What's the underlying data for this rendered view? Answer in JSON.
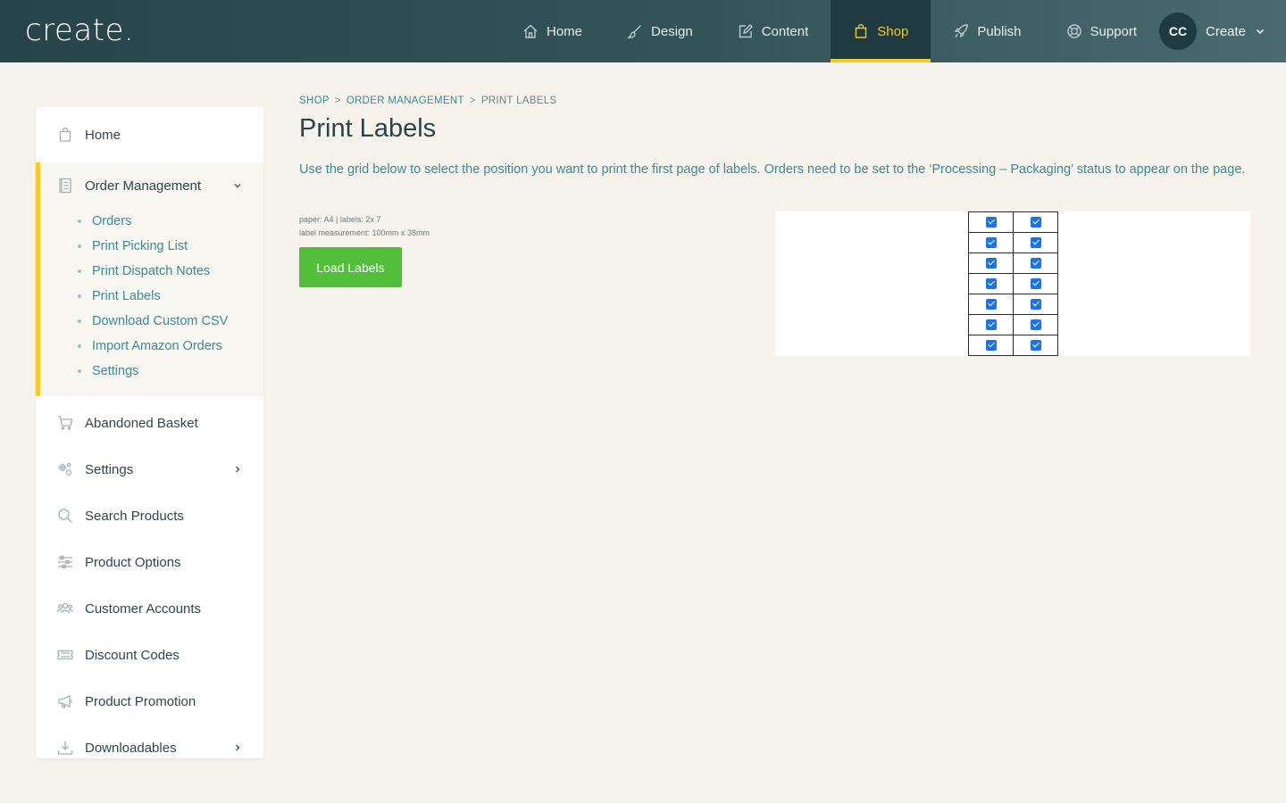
{
  "brand": {
    "logo_text": "create."
  },
  "nav": [
    {
      "label": "Home",
      "icon": "home-icon",
      "active": false
    },
    {
      "label": "Design",
      "icon": "brush-icon",
      "active": false
    },
    {
      "label": "Content",
      "icon": "edit-icon",
      "active": false
    },
    {
      "label": "Shop",
      "icon": "bag-icon",
      "active": true
    },
    {
      "label": "Publish",
      "icon": "rocket-icon",
      "active": false
    },
    {
      "label": "Support",
      "icon": "lifebuoy-icon",
      "active": false
    }
  ],
  "user": {
    "initials": "CC",
    "name": "Create"
  },
  "sidebar": {
    "home": "Home",
    "order_management": {
      "label": "Order Management",
      "items": [
        "Orders",
        "Print Picking List",
        "Print Dispatch Notes",
        "Print Labels",
        "Download Custom CSV",
        "Import Amazon Orders",
        "Settings"
      ]
    },
    "items": [
      {
        "label": "Abandoned Basket",
        "icon": "cart-icon",
        "has_arrow": false
      },
      {
        "label": "Settings",
        "icon": "gears-icon",
        "has_arrow": true
      },
      {
        "label": "Search Products",
        "icon": "search-icon",
        "has_arrow": false
      },
      {
        "label": "Product Options",
        "icon": "sliders-icon",
        "has_arrow": false
      },
      {
        "label": "Customer Accounts",
        "icon": "users-icon",
        "has_arrow": false
      },
      {
        "label": "Discount Codes",
        "icon": "ticket-icon",
        "has_arrow": false
      },
      {
        "label": "Product Promotion",
        "icon": "megaphone-icon",
        "has_arrow": false
      },
      {
        "label": "Downloadables",
        "icon": "download-icon",
        "has_arrow": true
      }
    ]
  },
  "breadcrumb": {
    "shop": "SHOP",
    "order_management": "ORDER MANAGEMENT",
    "current": "PRINT LABELS",
    "separator": ">"
  },
  "page": {
    "title": "Print Labels",
    "intro": "Use the grid below to select the position you want to print the first page of labels. Orders need to be set to the ‘Processing – Packaging’ status to appear on the page.",
    "spec_line1": "paper: A4 | labels: 2x 7",
    "spec_line2": "label measurement: 100mm x 38mm",
    "load_button": "Load Labels"
  },
  "label_grid": {
    "columns": 2,
    "rows": 7,
    "checked": true
  },
  "colors": {
    "accent_yellow": "#f4cb22",
    "teal_link": "#3f8b94",
    "button_green": "#52bf3b",
    "topbar": "#2f4f55"
  }
}
